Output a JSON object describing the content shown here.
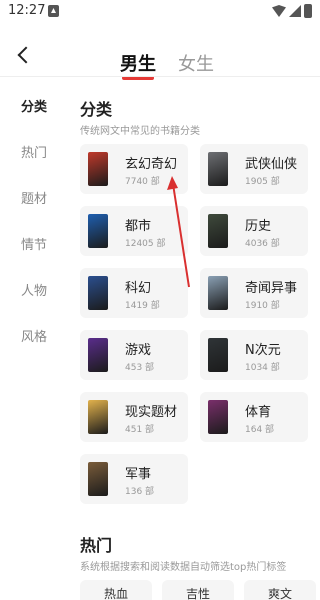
{
  "status_bar": {
    "time": "12:27"
  },
  "header": {
    "tabs": [
      {
        "label": "男生",
        "active": true
      },
      {
        "label": "女生",
        "active": false
      }
    ],
    "accent_color": "#e53935"
  },
  "sidebar": {
    "items": [
      {
        "label": "分类",
        "active": true
      },
      {
        "label": "热门",
        "active": false
      },
      {
        "label": "题材",
        "active": false
      },
      {
        "label": "情节",
        "active": false
      },
      {
        "label": "人物",
        "active": false
      },
      {
        "label": "风格",
        "active": false
      }
    ]
  },
  "category_section": {
    "title": "分类",
    "subtitle": "传统网文中常见的书籍分类",
    "items": [
      {
        "name": "玄幻奇幻",
        "count": "7740 部",
        "cover_color": "#c0392b"
      },
      {
        "name": "武侠仙侠",
        "count": "1905 部",
        "cover_color": "#6d6f73"
      },
      {
        "name": "都市",
        "count": "12405 部",
        "cover_color": "#1f5fb0"
      },
      {
        "name": "历史",
        "count": "4036 部",
        "cover_color": "#3f4a3c"
      },
      {
        "name": "科幻",
        "count": "1419 部",
        "cover_color": "#2b4f8f"
      },
      {
        "name": "奇闻异事",
        "count": "1910 部",
        "cover_color": "#8aa0b4"
      },
      {
        "name": "游戏",
        "count": "453 部",
        "cover_color": "#5a2d8c"
      },
      {
        "name": "N次元",
        "count": "1034 部",
        "cover_color": "#2f3437"
      },
      {
        "name": "现实题材",
        "count": "451 部",
        "cover_color": "#e2b24c"
      },
      {
        "name": "体育",
        "count": "164 部",
        "cover_color": "#7a2f6b"
      },
      {
        "name": "军事",
        "count": "136 部",
        "cover_color": "#7a5c3a"
      }
    ]
  },
  "hot_section": {
    "title": "热门",
    "subtitle": "系统根据搜索和阅读数据自动筛选top热门标签",
    "tags": [
      "热血",
      "吉性",
      "爽文"
    ]
  },
  "annotation": {
    "arrow_color": "#d93030"
  }
}
